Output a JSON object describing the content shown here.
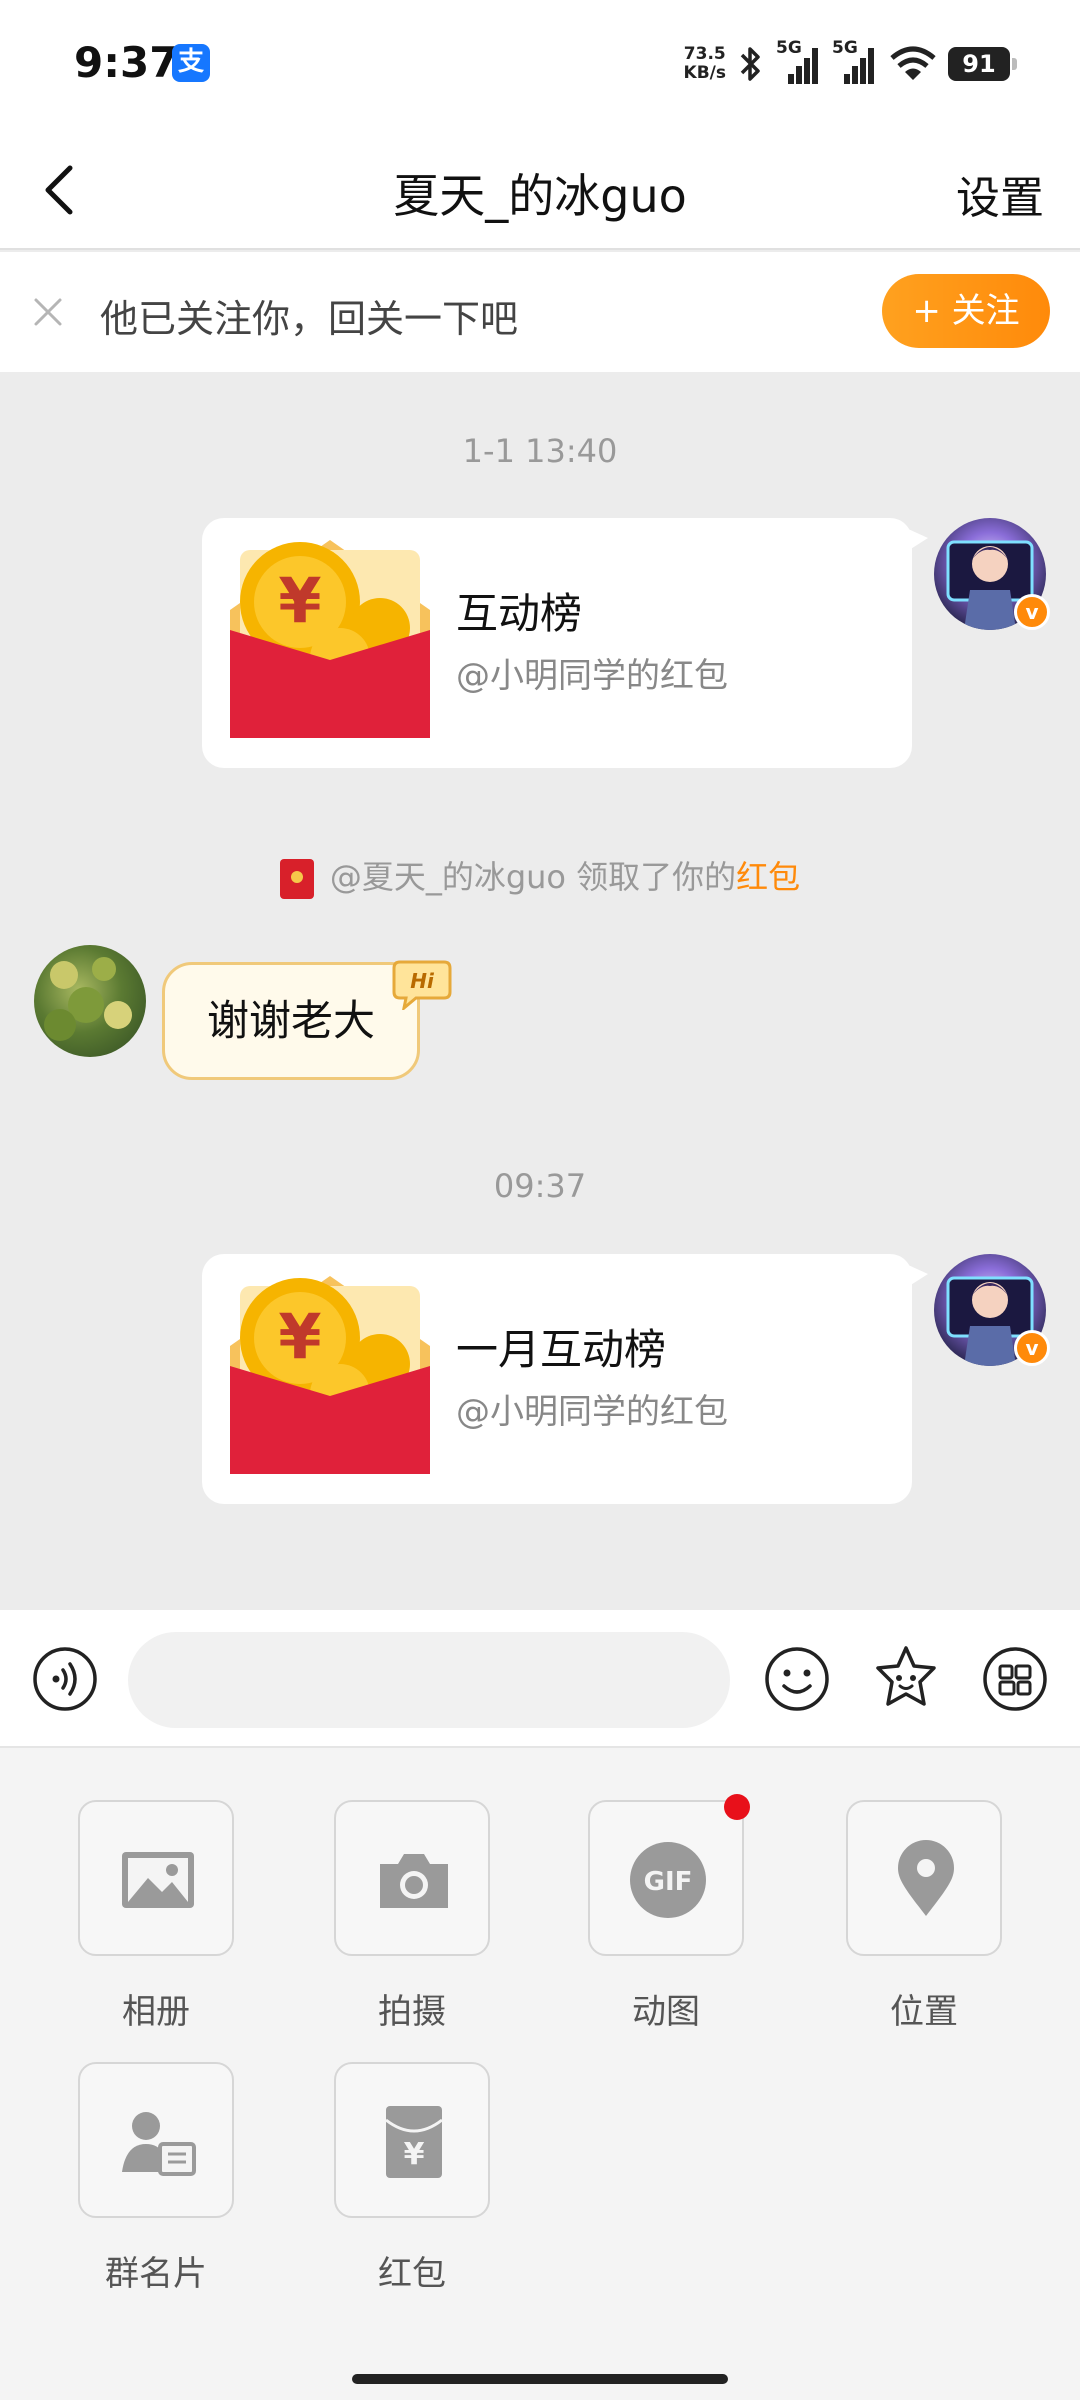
{
  "status_bar": {
    "time": "9:37",
    "net_speed_value": "73.5",
    "net_speed_unit": "KB/s",
    "signal_label_1": "5G",
    "signal_label_2": "5G",
    "battery": "91"
  },
  "header": {
    "title": "夏天_的冰guo",
    "settings_label": "设置"
  },
  "follow_banner": {
    "text": "他已关注你，回关一下吧",
    "button_label": "+ 关注"
  },
  "chat": {
    "timestamp_1": "1-1 13:40",
    "card_1": {
      "title": "互动榜",
      "subtitle": "@小明同学的红包"
    },
    "notice": {
      "prefix": "@夏天_的冰guo 领取了你的",
      "highlight": "红包"
    },
    "message_text": "谢谢老大",
    "hi_badge": "Hi",
    "timestamp_2": "09:37",
    "card_2": {
      "title": "一月互动榜",
      "subtitle": "@小明同学的红包"
    }
  },
  "input_bar": {
    "icons": [
      "voice-icon",
      "emoji-icon",
      "sticker-icon",
      "more-icon"
    ]
  },
  "more_panel": {
    "items": [
      {
        "label": "相册",
        "icon": "album-icon"
      },
      {
        "label": "拍摄",
        "icon": "camera-icon"
      },
      {
        "label": "动图",
        "icon": "gif-icon",
        "badge_text": "GIF"
      },
      {
        "label": "位置",
        "icon": "location-icon"
      },
      {
        "label": "群名片",
        "icon": "contact-card-icon"
      },
      {
        "label": "红包",
        "icon": "red-packet-icon"
      }
    ]
  },
  "colors": {
    "accent": "#ff8a0a",
    "red_packet": "#d8202a",
    "badge_red": "#e8101a"
  }
}
